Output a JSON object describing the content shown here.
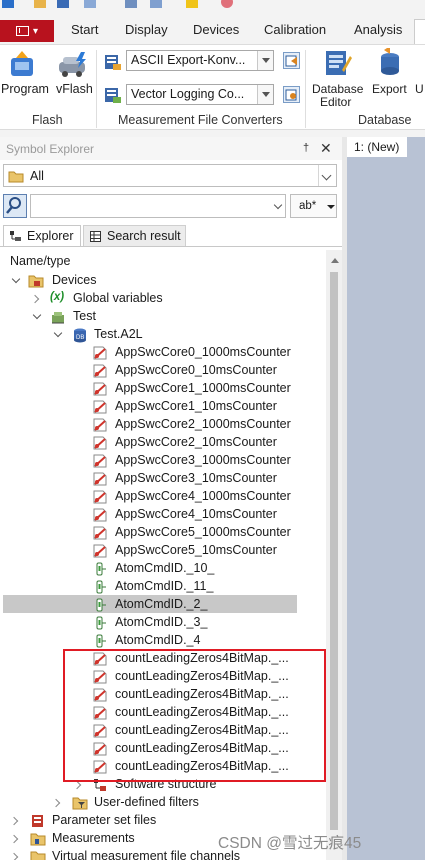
{
  "ribbon": {
    "file_tab_label": "",
    "tabs": [
      "Start",
      "Display",
      "Devices",
      "Calibration",
      "Analysis"
    ],
    "flash_group": {
      "program_label": "Program",
      "vflash_label": "vFlash",
      "group_label": "Flash"
    },
    "converters_group": {
      "combo1_value": "ASCII Export-Konv...",
      "combo2_value": "Vector Logging Co...",
      "group_label": "Measurement File Converters"
    },
    "database_group": {
      "editor_label_1": "Database",
      "editor_label_2": "Editor",
      "export_label": "Export",
      "overflow_label": "U",
      "group_label": "Database"
    }
  },
  "symbol_explorer": {
    "title": "Symbol Explorer",
    "pin_glyph": "†",
    "close_glyph": "✕",
    "filter_value": "All",
    "search_value": "",
    "search_mode_label": "ab*",
    "tabs": [
      "Explorer",
      "Search result"
    ],
    "column_header": "Name/type",
    "tree": [
      {
        "label": "Devices",
        "icon": "devices-folder-icon"
      },
      {
        "label": "Global variables",
        "icon": "global-variables-icon",
        "icon_text": "(x)"
      },
      {
        "label": "Test",
        "icon": "device-icon"
      },
      {
        "label": "Test.A2L",
        "icon": "database-icon"
      },
      {
        "label": "AppSwcCore0_1000msCounter",
        "icon": "measurement-icon"
      },
      {
        "label": "AppSwcCore0_10msCounter",
        "icon": "measurement-icon"
      },
      {
        "label": "AppSwcCore1_1000msCounter",
        "icon": "measurement-icon"
      },
      {
        "label": "AppSwcCore1_10msCounter",
        "icon": "measurement-icon"
      },
      {
        "label": "AppSwcCore2_1000msCounter",
        "icon": "measurement-icon"
      },
      {
        "label": "AppSwcCore2_10msCounter",
        "icon": "measurement-icon"
      },
      {
        "label": "AppSwcCore3_1000msCounter",
        "icon": "measurement-icon"
      },
      {
        "label": "AppSwcCore3_10msCounter",
        "icon": "measurement-icon"
      },
      {
        "label": "AppSwcCore4_1000msCounter",
        "icon": "measurement-icon"
      },
      {
        "label": "AppSwcCore4_10msCounter",
        "icon": "measurement-icon"
      },
      {
        "label": "AppSwcCore5_1000msCounter",
        "icon": "measurement-icon"
      },
      {
        "label": "AppSwcCore5_10msCounter",
        "icon": "measurement-icon"
      },
      {
        "label": "AtomCmdID._10_",
        "icon": "parameter-icon"
      },
      {
        "label": "AtomCmdID._11_",
        "icon": "parameter-icon"
      },
      {
        "label": "AtomCmdID._2_",
        "icon": "parameter-icon",
        "selected": true
      },
      {
        "label": "AtomCmdID._3_",
        "icon": "parameter-icon"
      },
      {
        "label": "AtomCmdID._4",
        "icon": "parameter-icon"
      },
      {
        "label": "countLeadingZeros4BitMap._...",
        "icon": "measurement-icon"
      },
      {
        "label": "countLeadingZeros4BitMap._...",
        "icon": "measurement-icon"
      },
      {
        "label": "countLeadingZeros4BitMap._...",
        "icon": "measurement-icon"
      },
      {
        "label": "countLeadingZeros4BitMap._...",
        "icon": "measurement-icon"
      },
      {
        "label": "countLeadingZeros4BitMap._...",
        "icon": "measurement-icon"
      },
      {
        "label": "countLeadingZeros4BitMap._...",
        "icon": "measurement-icon"
      },
      {
        "label": "countLeadingZeros4BitMap._...",
        "icon": "measurement-icon"
      },
      {
        "label": "Software structure",
        "icon": "software-structure-icon"
      },
      {
        "label": "User-defined filters",
        "icon": "filter-folder-icon"
      },
      {
        "label": "Parameter set files",
        "icon": "parameter-set-icon"
      },
      {
        "label": "Measurements",
        "icon": "measurements-folder-icon"
      },
      {
        "label": "Virtual measurement file channels",
        "icon": "virtual-channels-icon"
      }
    ]
  },
  "document": {
    "tab_label": "1: (New)"
  },
  "watermark": "CSDN @雪过无痕45",
  "colors": {
    "file_tab": "#b8121e",
    "highlight_box": "#e01b24",
    "selected_row": "#c8c8c8",
    "document_bg": "#b8c2d4"
  }
}
